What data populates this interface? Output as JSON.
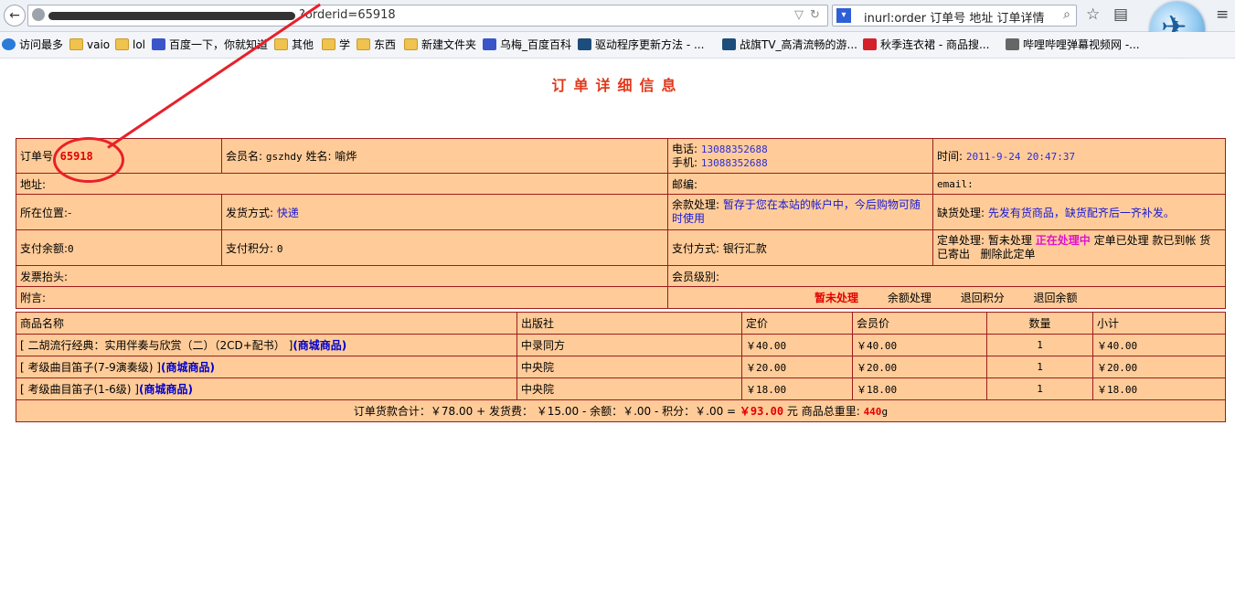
{
  "browser": {
    "url_suffix": "?orderid=65918",
    "search_text": "inurl:order 订单号 地址 订单详情",
    "bookmarks": [
      "访问最多",
      "vaio",
      "lol",
      "百度一下，你就知道",
      "其他",
      "学",
      "东西",
      "新建文件夹",
      "乌梅_百度百科",
      "驱动程序更新方法 - ...",
      "战旗TV_高清流畅的游...",
      "秋季连衣裙 - 商品搜...",
      "哔哩哔哩弹幕视频网 -..."
    ]
  },
  "page": {
    "title": "订单详细信息"
  },
  "order": {
    "order_no_label": "订单号",
    "order_no": "65918",
    "member_label": "会员名:",
    "member": "gszhdy",
    "name_label": "姓名:",
    "name": "喻烨",
    "phone_label": "电话:",
    "phone": "13088352688",
    "mobile_label": "手机:",
    "mobile": "13088352688",
    "time_label": "时间:",
    "time": "2011-9-24 20:47:37",
    "address_label": "地址:",
    "zip_label": "邮编:",
    "email_label": "email:",
    "location_label": "所在位置:",
    "location": "-",
    "shipping_label": "发货方式:",
    "shipping": "快递",
    "balance_label": "余款处理:",
    "balance": "暂存于您在本站的帐户中，今后购物可随时使用",
    "shortage_label": "缺货处理:",
    "shortage": "先发有货商品，缺货配齐后一齐补发。",
    "pay_balance_label": "支付余额:",
    "pay_balance": "0",
    "pay_points_label": "支付积分:",
    "pay_points": "0",
    "pay_method_label": "支付方式:",
    "pay_method": "银行汇款",
    "status_label": "定单处理:",
    "status_pending": "暂未处理",
    "status_current": "正在处理中",
    "status_done": "定单已处理",
    "status_paid": "款已到帐",
    "status_sent": "货已寄出",
    "status_delete": "删除此定单",
    "invoice_label": "发票抬头:",
    "level_label": "会员级别:",
    "note_label": "附言:",
    "action_current": "暂未处理",
    "action_balance": "余额处理",
    "action_refund_points": "退回积分",
    "action_refund_balance": "退回余额"
  },
  "goods": {
    "headers": [
      "商品名称",
      "出版社",
      "定价",
      "会员价",
      "数量",
      "小计"
    ],
    "tag": "(商城商品)",
    "rows": [
      {
        "name": "[ 二胡流行经典：实用伴奏与欣赏（二）（2CD+配书） ]",
        "publisher": "中录同方",
        "price": "￥40.00",
        "member_price": "￥40.00",
        "qty": "1",
        "subtotal": "￥40.00"
      },
      {
        "name": "[ 考级曲目笛子(7-9演奏级) ]",
        "publisher": "中央院",
        "price": "￥20.00",
        "member_price": "￥20.00",
        "qty": "1",
        "subtotal": "￥20.00"
      },
      {
        "name": "[ 考级曲目笛子(1-6级) ]",
        "publisher": "中央院",
        "price": "￥18.00",
        "member_price": "￥18.00",
        "qty": "1",
        "subtotal": "￥18.00"
      }
    ]
  },
  "summary": {
    "prefix": "订单货款合计：￥78.00 + 发货费： ￥15.00 - 余额：￥.00 - 积分：￥.00 =",
    "total": "￥93.00",
    "unit": "元 商品总重里:",
    "weight": "440",
    "weight_unit": "g"
  }
}
